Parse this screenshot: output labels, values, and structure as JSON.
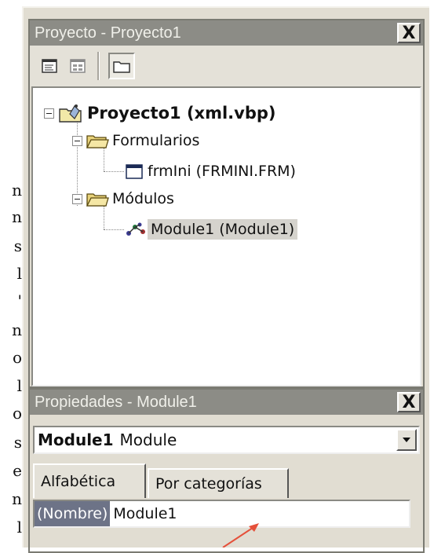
{
  "edge_text": [
    "n",
    "n",
    "s",
    "l",
    "'",
    "n",
    "o",
    "l",
    "o",
    "s",
    "e",
    "n",
    "l"
  ],
  "project_explorer": {
    "title": "Proyecto - Proyecto1",
    "close_glyph": "X",
    "toolbar": {
      "view_code_icon": "view-code-icon",
      "view_object_icon": "view-object-icon",
      "toggle_folders_icon": "folder-icon"
    },
    "tree": {
      "root": "Proyecto1 (xml.vbp)",
      "forms_folder": "Formularios",
      "form_item": "frmIni (FRMINI.FRM)",
      "modules_folder": "Módulos",
      "module_item": "Module1 (Module1)"
    }
  },
  "properties": {
    "title": "Propiedades - Module1",
    "close_glyph": "X",
    "object_combo": {
      "name": "Module1",
      "type": "Module"
    },
    "tabs": [
      "Alfabética",
      "Por categorías"
    ],
    "rows": [
      {
        "name": "(Nombre)",
        "value": "Module1"
      }
    ]
  },
  "colors": {
    "title_inactive": "#8c8c86",
    "frame": "#e1ddd2",
    "selection": "#d5d3cd",
    "prop_name_bg": "#6d7387",
    "annotation_arrow": "#e5503a"
  }
}
